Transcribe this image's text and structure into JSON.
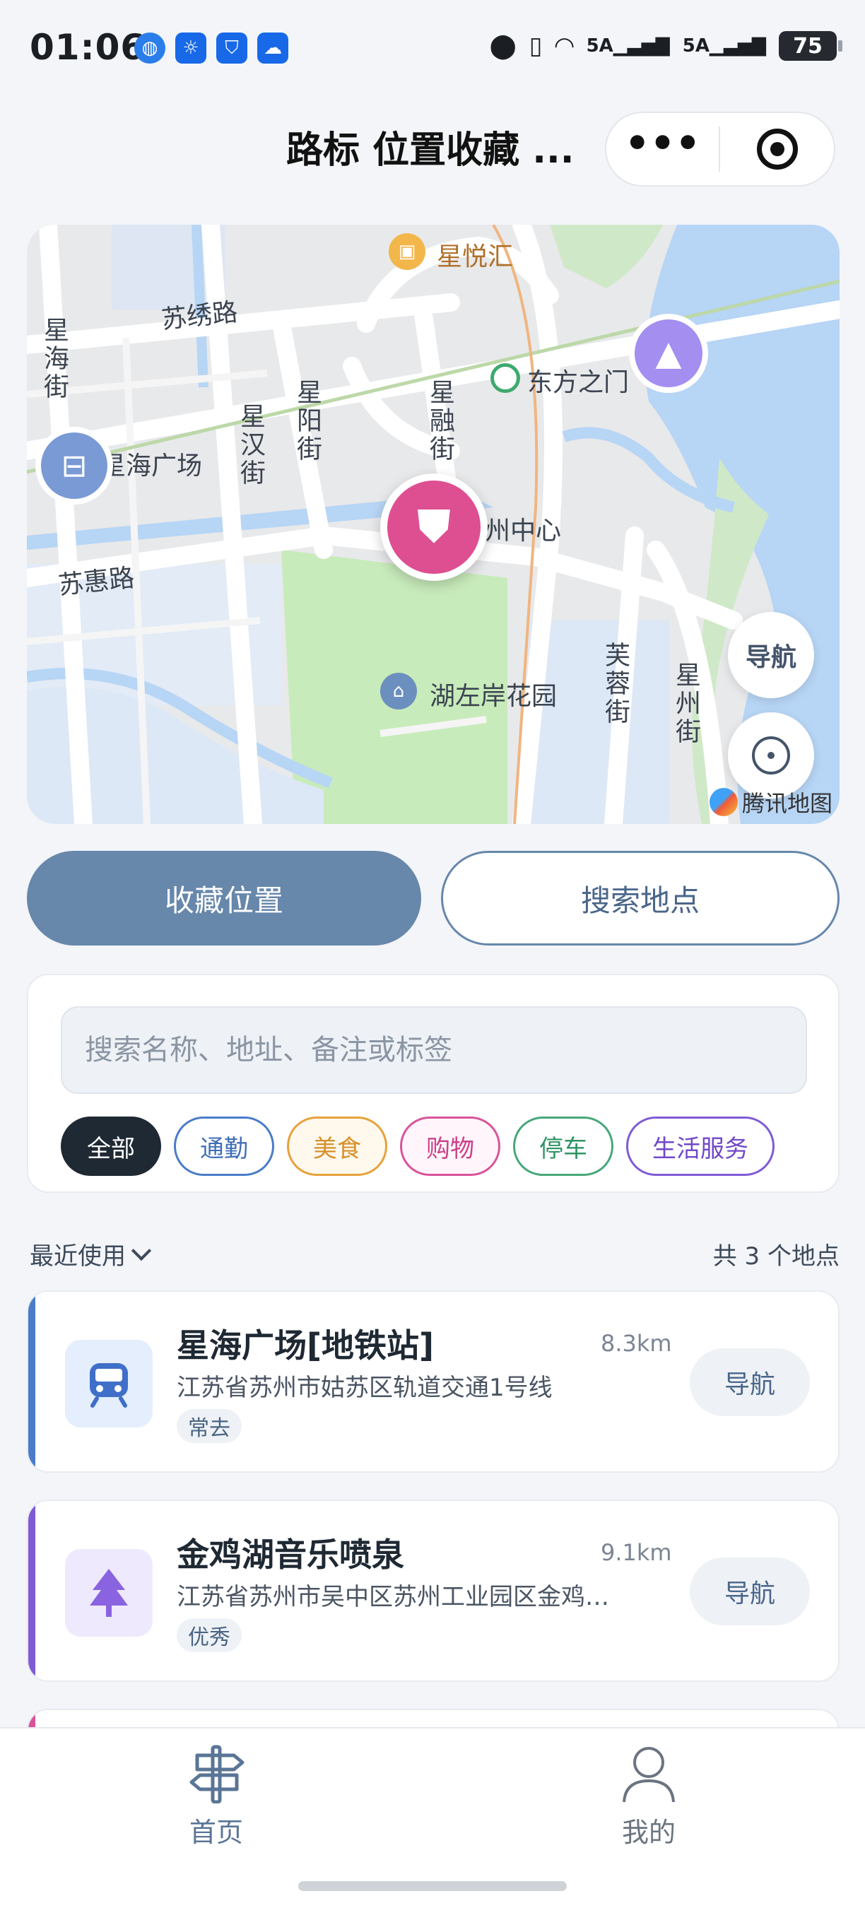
{
  "status_bar": {
    "time": "01:06",
    "signal1": "5A",
    "signal2": "5A",
    "battery": "75"
  },
  "header": {
    "title": "路标 位置收藏 ...",
    "more_glyph": "•••"
  },
  "map": {
    "labels": {
      "mall": "星悦汇",
      "xinghai_road": "星海街",
      "xiuxiu_road": "苏绣路",
      "xinghan": "星汉街",
      "xingyang": "星阳街",
      "xingrong": "星融街",
      "east_gate": "东方之门",
      "xinghai_square": "星海广场",
      "suzhou_center": "州中心",
      "suhui_road": "苏惠路",
      "hupan_garden": "湖左岸花园",
      "furong": "芙蓉街",
      "xingzhou": "星州街"
    },
    "nav_label": "导航",
    "brand": "腾讯地图"
  },
  "actions": {
    "save_label": "收藏位置",
    "search_label": "搜索地点"
  },
  "filter": {
    "search_placeholder": "搜索名称、地址、备注或标签",
    "chips": [
      {
        "label": "全部",
        "color": "#1f2933",
        "bg": "#1f2933",
        "text": "#ffffff"
      },
      {
        "label": "通勤",
        "color": "#4a7cc9",
        "bg": "#ffffff",
        "text": "#3f6fb6"
      },
      {
        "label": "美食",
        "color": "#e6a23c",
        "bg": "#fff8ec",
        "text": "#d7902a"
      },
      {
        "label": "购物",
        "color": "#d9539a",
        "bg": "#fff5fa",
        "text": "#cc3f89"
      },
      {
        "label": "停车",
        "color": "#48a77a",
        "bg": "#ffffff",
        "text": "#2f9465"
      },
      {
        "label": "生活服务",
        "color": "#7f5bd6",
        "bg": "#ffffff",
        "text": "#7048c8"
      }
    ]
  },
  "list": {
    "sort_label": "最近使用",
    "count_label": "共 3 个地点",
    "items": [
      {
        "name": "星海广场[地铁站]",
        "distance": "8.3km",
        "address": "江苏省苏州市姑苏区轨道交通1号线",
        "tag": "常去",
        "nav": "导航",
        "accent": "#4a7cc9",
        "icon": "metro-icon"
      },
      {
        "name": "金鸡湖音乐喷泉",
        "distance": "9.1km",
        "address": "江苏省苏州市吴中区苏州工业园区金鸡…",
        "tag": "优秀",
        "nav": "导航",
        "accent": "#7f5bd6",
        "icon": "tree-icon"
      }
    ]
  },
  "tabbar": {
    "home": "首页",
    "mine": "我的",
    "home_color": "#5a7596",
    "mine_color": "#6b7480"
  }
}
